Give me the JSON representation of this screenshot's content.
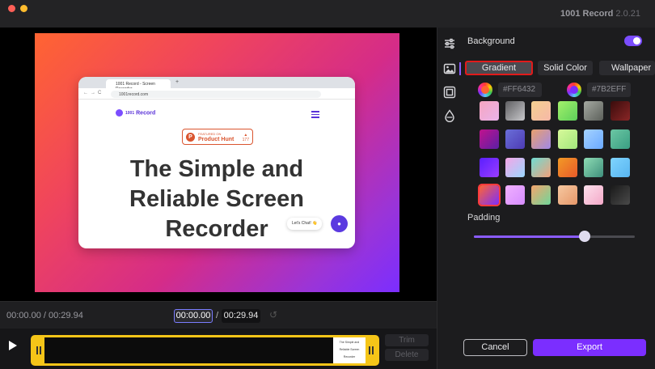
{
  "window": {
    "app_name": "1001 Record",
    "version": "2.0.21"
  },
  "preview": {
    "background_gradient": [
      "#FF6432",
      "#7B2EFF"
    ],
    "browser": {
      "tab_title": "1001 Record - Screen Recorder",
      "url": "1001record.com",
      "site_name": "Record",
      "logo_prefix": "1001",
      "producthunt": {
        "featured": "FEATURED ON",
        "name": "Product Hunt",
        "votes": "177"
      },
      "hero_line1": "The Simple and",
      "hero_line2": "Reliable Screen",
      "hero_line3": "Recorder",
      "chat_label": "Let's Chat! 👋"
    }
  },
  "timeline": {
    "total_label": "00:00.00 / 00:29.94",
    "in_time": "00:00.00",
    "separator": "/",
    "out_time": "00:29.94",
    "thumb_lines": [
      "The Simple and",
      "Reliable Screen",
      "Recorder"
    ]
  },
  "trim_label": "Trim",
  "delete_label": "Delete",
  "sidebar_icons": [
    "sliders-icon",
    "image-icon",
    "frame-icon",
    "droplet-icon"
  ],
  "panel": {
    "background_label": "Background",
    "background_enabled": true,
    "tabs": [
      "Gradient",
      "Solid Color",
      "Wallpaper"
    ],
    "active_tab": "Gradient",
    "color_from": "#FF6432",
    "color_to": "#7B2EFF",
    "padding_label": "Padding",
    "padding_fraction": 0.69,
    "swatches": [
      [
        "#f6a5c0",
        "#e9b3ea"
      ],
      [
        "#5f5f62",
        "#c9c9cc"
      ],
      [
        "#f4d090",
        "#f7b8a8"
      ],
      [
        "#a3f06b",
        "#5dd05a"
      ],
      [
        "#a5a9a2",
        "#5c605a"
      ],
      [
        "#3a0c0c",
        "#8a2626"
      ],
      [
        "#c1128d",
        "#5b1fa6"
      ],
      [
        "#6a6fd8",
        "#4d3bb4"
      ],
      [
        "#e9a06c",
        "#a088e8"
      ],
      [
        "#d7f99a",
        "#a2e67c"
      ],
      [
        "#a5d2ff",
        "#6aa9ff"
      ],
      [
        "#6bc6a3",
        "#3a9f83"
      ],
      [
        "#5a1fff",
        "#9a3dff"
      ],
      [
        "#f6a5e6",
        "#9ad7ff"
      ],
      [
        "#6edcd3",
        "#f2a07a"
      ],
      [
        "#f29a26",
        "#e85a2a"
      ],
      [
        "#8edcb4",
        "#3f8f7c"
      ],
      [
        "#7fd4ff",
        "#58b5f0"
      ],
      [
        "#ff6432",
        "#7b2eff"
      ],
      [
        "#f0b0ff",
        "#d68cff"
      ],
      [
        "#f5a56c",
        "#6fd69a"
      ],
      [
        "#f6c8a0",
        "#e6986a"
      ],
      [
        "#fde0ec",
        "#f3a8c8"
      ],
      [
        "#1a1a1a",
        "#4a4a4a"
      ]
    ],
    "selected_swatch": 18,
    "cancel_label": "Cancel",
    "export_label": "Export"
  }
}
